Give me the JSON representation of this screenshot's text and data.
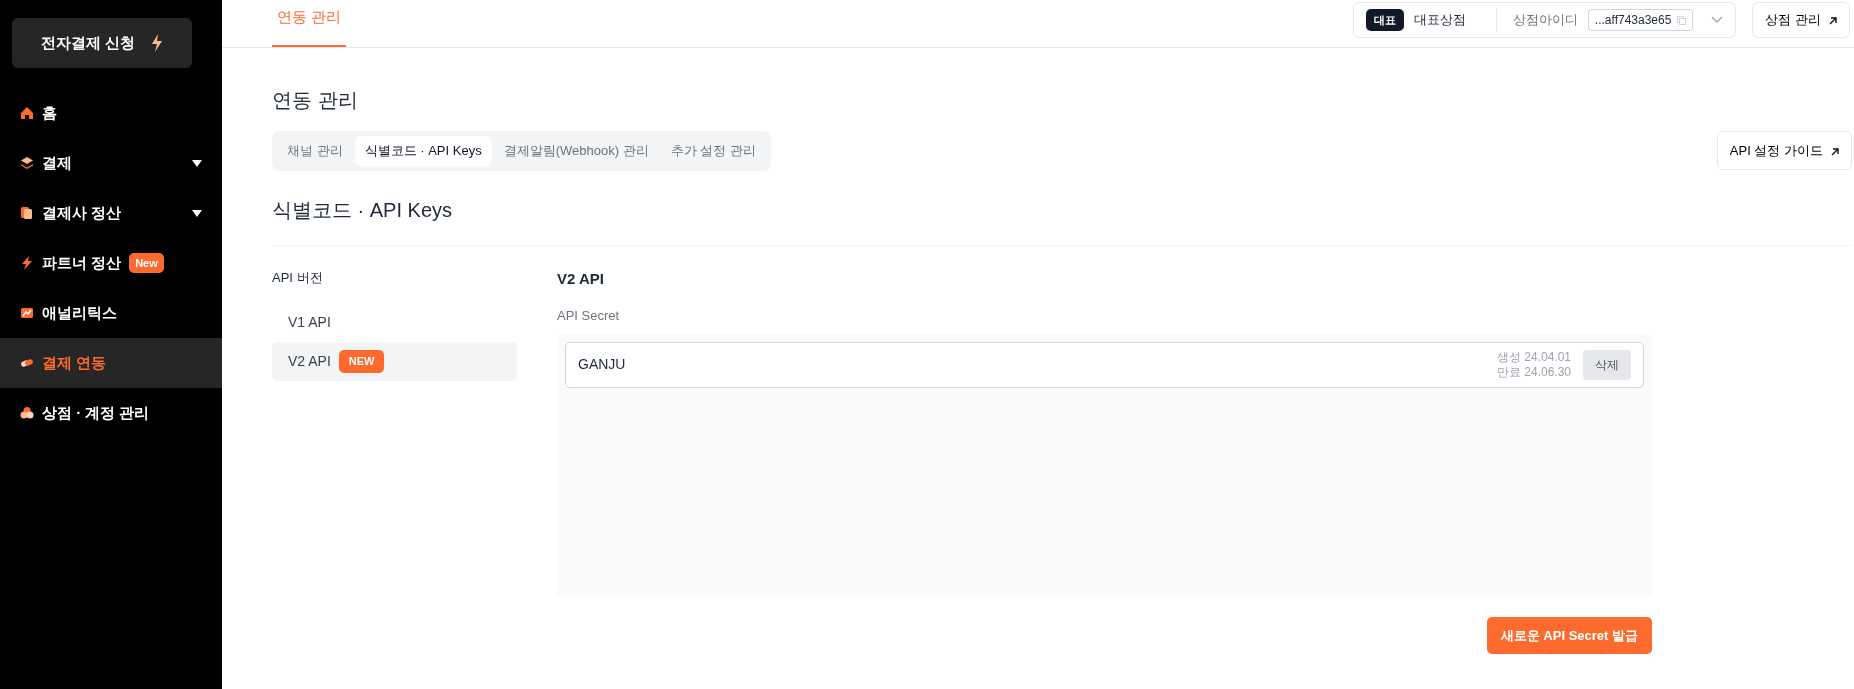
{
  "sidebar": {
    "apply_button": "전자결제 신청",
    "items": [
      {
        "label": "홈",
        "kind": "link",
        "selected": false
      },
      {
        "label": "결제",
        "kind": "group",
        "selected": false
      },
      {
        "label": "결제사 정산",
        "kind": "group",
        "selected": false
      },
      {
        "label": "파트너 정산",
        "kind": "link",
        "selected": false,
        "badge": "New"
      },
      {
        "label": "애널리틱스",
        "kind": "link",
        "selected": false
      },
      {
        "label": "결제 연동",
        "kind": "link",
        "selected": true
      },
      {
        "label": "상점 · 계정 관리",
        "kind": "link",
        "selected": false
      }
    ]
  },
  "top_bar": {
    "tabs": [
      {
        "label": "연동 관리",
        "selected": true
      }
    ],
    "merchant": {
      "badge": "대표",
      "name": "대표상점",
      "id_label": "상점아이디",
      "id_value": "...aff743a3e65"
    },
    "manage_button": "상점 관리"
  },
  "page": {
    "title": "연동 관리",
    "tabs": [
      {
        "label": "채널 관리",
        "selected": false
      },
      {
        "label": "식별코드 · API Keys",
        "selected": true
      },
      {
        "label": "결제알림(Webhook) 관리",
        "selected": false
      },
      {
        "label": "추가 설정 관리",
        "selected": false
      }
    ],
    "guide_button": "API 설정 가이드",
    "section_title": "식별코드 · API Keys",
    "versions": {
      "label": "API 버전",
      "items": [
        {
          "label": "V1 API",
          "selected": false
        },
        {
          "label": "V2 API",
          "selected": true,
          "badge": "NEW"
        }
      ]
    },
    "detail": {
      "title": "V2 API",
      "secret_label": "API Secret",
      "secrets": [
        {
          "name": "GANJU",
          "created": "생성 24.04.01",
          "expires": "만료 24.06.30",
          "delete_button": "삭제"
        }
      ],
      "issue_button": "새로운 API Secret 발급"
    }
  }
}
